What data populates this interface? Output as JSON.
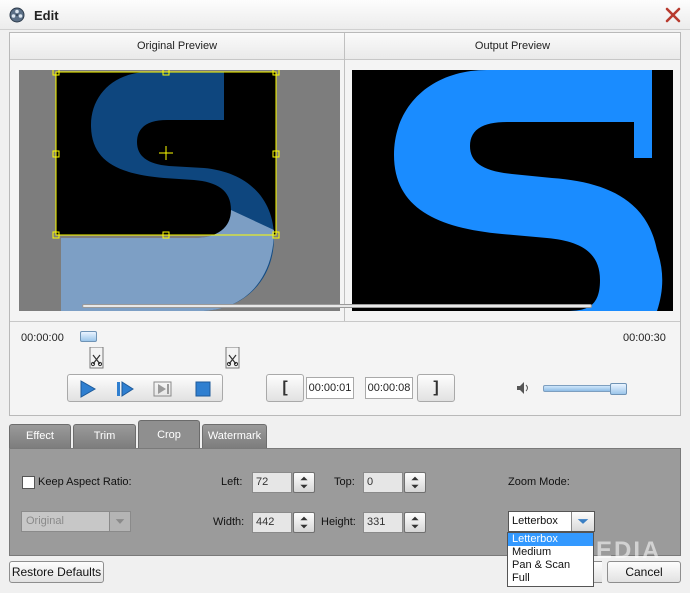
{
  "window": {
    "title": "Edit"
  },
  "preview": {
    "original_label": "Original Preview",
    "output_label": "Output Preview",
    "colors": {
      "logo_blue": "#1a8cff",
      "dim_logo": "#0b3f73",
      "crop_outline": "#ffff00"
    }
  },
  "timeline": {
    "start_time": "00:00:00",
    "end_time": "00:00:30",
    "position_fraction": 0.0
  },
  "trim": {
    "start": "00:00:01",
    "end": "00:00:08",
    "open_bracket": "[",
    "close_bracket": "]"
  },
  "volume": {
    "level_fraction": 0.9
  },
  "tabs": [
    {
      "label": "Effect",
      "active": false
    },
    {
      "label": "Trim",
      "active": false
    },
    {
      "label": "Crop",
      "active": true
    },
    {
      "label": "Watermark",
      "active": false
    }
  ],
  "crop": {
    "keep_aspect_label": "Keep Aspect Ratio:",
    "keep_aspect_checked": false,
    "aspect_value": "Original",
    "left_label": "Left:",
    "left_value": "72",
    "top_label": "Top:",
    "top_value": "0",
    "width_label": "Width:",
    "width_value": "442",
    "height_label": "Height:",
    "height_value": "331",
    "zoom_label": "Zoom Mode:",
    "zoom_value": "Letterbox",
    "zoom_options": [
      "Letterbox",
      "Medium",
      "Pan & Scan",
      "Full"
    ],
    "zoom_selected_index": 0
  },
  "footer": {
    "restore_label": "Restore Defaults",
    "cancel_label": "Cancel"
  },
  "watermark_text": "SOFTPEDIA"
}
